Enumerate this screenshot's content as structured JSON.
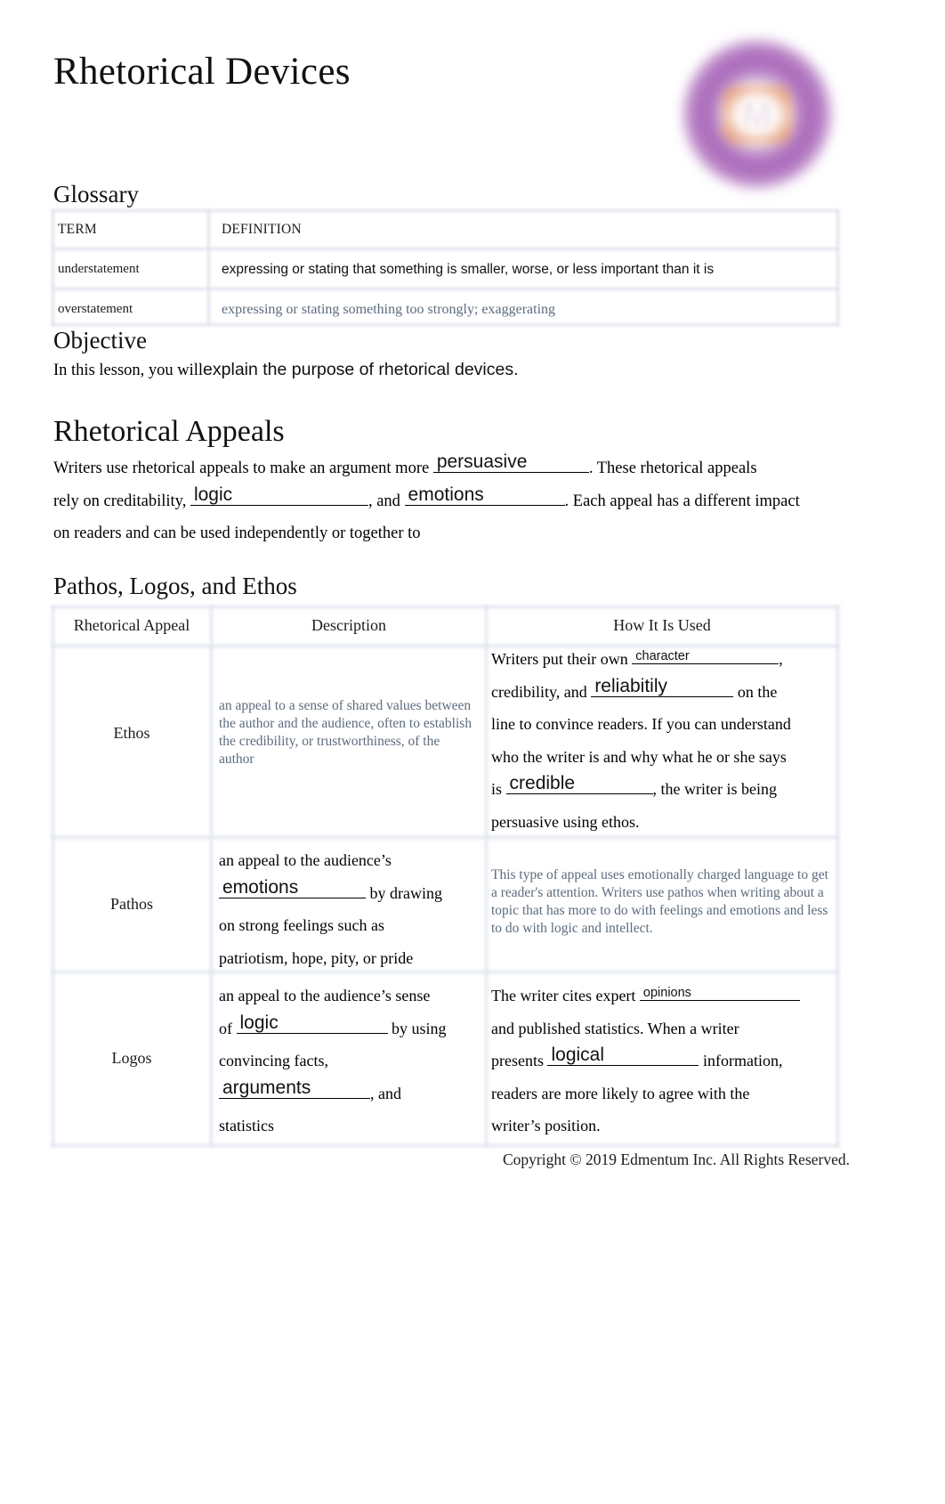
{
  "document": {
    "title": "Rhetorical Devices",
    "logo_glyph": "M",
    "copyright": "Copyright © 2019 Edmentum Inc. All Rights Reserved."
  },
  "glossary": {
    "heading": "Glossary",
    "columns": [
      "TERM",
      "DEFINITION"
    ],
    "rows": [
      {
        "term": "understatement",
        "definition": "expressing or stating that something is smaller, worse, or less important than it is",
        "filled_by_user": true
      },
      {
        "term": "overstatement",
        "definition": "expressing or stating something too strongly; exaggerating",
        "filled_by_user": false
      }
    ]
  },
  "objective": {
    "heading": "Objective",
    "prompt": "In this lesson, you will",
    "answer": "explain the purpose of rhetorical devices."
  },
  "rhetorical_appeals": {
    "heading": "Rhetorical Appeals",
    "text_1": "Writers use rhetorical appeals to make an argument more",
    "answer_1": "persuasive",
    "text_2": ". These rhetorical appeals",
    "text_3": "rely on creditability,",
    "answer_2": "logic",
    "text_4": ", and",
    "answer_3": "emotions",
    "text_5": ". Each appeal has a different impact",
    "text_6": "on readers and can be used independently or together to"
  },
  "appeals_table": {
    "heading": "Pathos, Logos, and Ethos",
    "columns": [
      "Rhetorical Appeal",
      "Description",
      "How It Is Used"
    ],
    "rows": [
      {
        "appeal": "Ethos",
        "description_prefilled": "an appeal to a sense of shared values between the author and the audience, often to establish the credibility, or trustworthiness, of the author",
        "usage": {
          "seg_1": "Writers put their own",
          "answer_1": "character",
          "seg_2": ",",
          "seg_3": "credibility, and",
          "answer_2": "reliabitily",
          "seg_4": "on the",
          "seg_5": "line to convince readers. If you can understand",
          "seg_6": "who the writer is and why what he or she says",
          "seg_7": "is",
          "answer_3": "credible",
          "seg_8": ", the writer is being",
          "seg_9": "persuasive using ethos."
        }
      },
      {
        "appeal": "Pathos",
        "description": {
          "seg_1": "an appeal to the audience’s",
          "answer_1": "emotions",
          "seg_2": "by drawing",
          "seg_3": "on strong feelings such as",
          "seg_4": "patriotism, hope, pity, or pride"
        },
        "usage_prefilled": "This type of appeal uses emotionally charged language to get a reader's attention. Writers use pathos when writing about a topic that has more to do with feelings and emotions and less to do with logic and intellect."
      },
      {
        "appeal": "Logos",
        "description": {
          "seg_1": "an appeal to the audience’s sense",
          "seg_2": "of",
          "answer_1": "logic",
          "seg_3": "by using",
          "seg_4": "convincing facts,",
          "answer_2": "arguments",
          "seg_5": ", and",
          "seg_6": "statistics"
        },
        "usage": {
          "seg_1": "The writer cites expert",
          "answer_1": "opinions",
          "seg_2": "and published statistics. When a writer",
          "seg_3": "presents",
          "answer_2": "logical",
          "seg_4": "information,",
          "seg_5": "readers are more likely to agree with the",
          "seg_6": "writer’s position."
        }
      }
    ]
  },
  "colors": {
    "prefilled_text": "#5c6b7d",
    "table_grid": "#dee3ed",
    "logo_purple": "#a058b2"
  }
}
